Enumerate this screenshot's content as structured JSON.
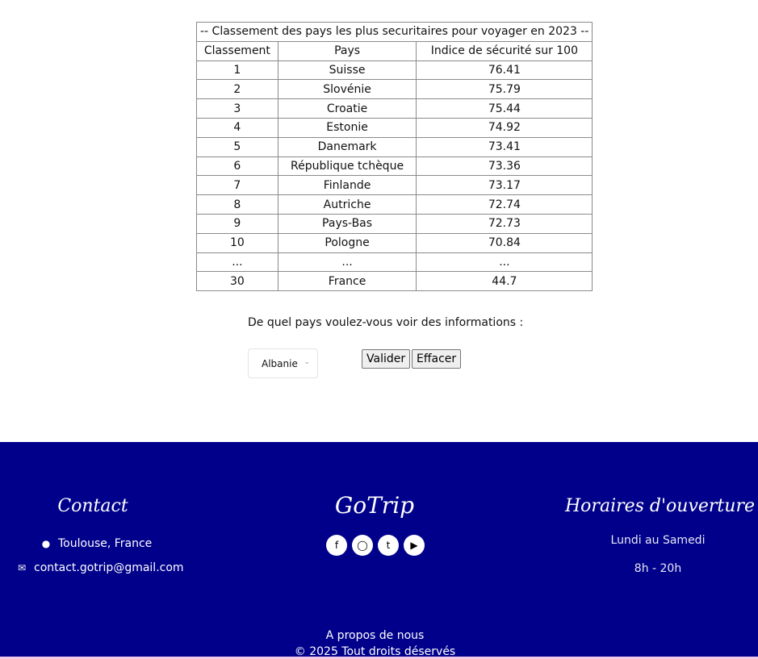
{
  "table": {
    "caption": "-- Classement des pays les plus securitaires pour voyager en 2023 --",
    "headers": [
      "Classement",
      "Pays",
      "Indice de sécurité sur 100"
    ],
    "rows": [
      [
        "1",
        "Suisse",
        "76.41"
      ],
      [
        "2",
        "Slovénie",
        "75.79"
      ],
      [
        "3",
        "Croatie",
        "75.44"
      ],
      [
        "4",
        "Estonie",
        "74.92"
      ],
      [
        "5",
        "Danemark",
        "73.41"
      ],
      [
        "6",
        "République tchèque",
        "73.36"
      ],
      [
        "7",
        "Finlande",
        "73.17"
      ],
      [
        "8",
        "Autriche",
        "72.74"
      ],
      [
        "9",
        "Pays-Bas",
        "72.73"
      ],
      [
        "10",
        "Pologne",
        "70.84"
      ],
      [
        "...",
        "...",
        "..."
      ],
      [
        "30",
        "France",
        "44.7"
      ]
    ]
  },
  "form": {
    "question": "De quel pays voulez-vous voir des informations :",
    "selected_country": "Albanie",
    "submit_label": "Valider",
    "clear_label": "Effacer"
  },
  "footer": {
    "contact_title": "Contact",
    "location": "Toulouse, France",
    "email": "contact.gotrip@gmail.com",
    "brand": "GoTrip",
    "social_icons": [
      "facebook-icon",
      "instagram-icon",
      "twitter-icon",
      "youtube-icon"
    ],
    "hours_title": "Horaires d'ouverture",
    "hours_days": "Lundi au Samedi",
    "hours_time": "8h - 20h",
    "about": "A propos de nous",
    "copyright": "© 2025 Tout droits déservés"
  },
  "colors": {
    "footer_bg": "#00008b",
    "accent_line": "#f6c8ea"
  }
}
